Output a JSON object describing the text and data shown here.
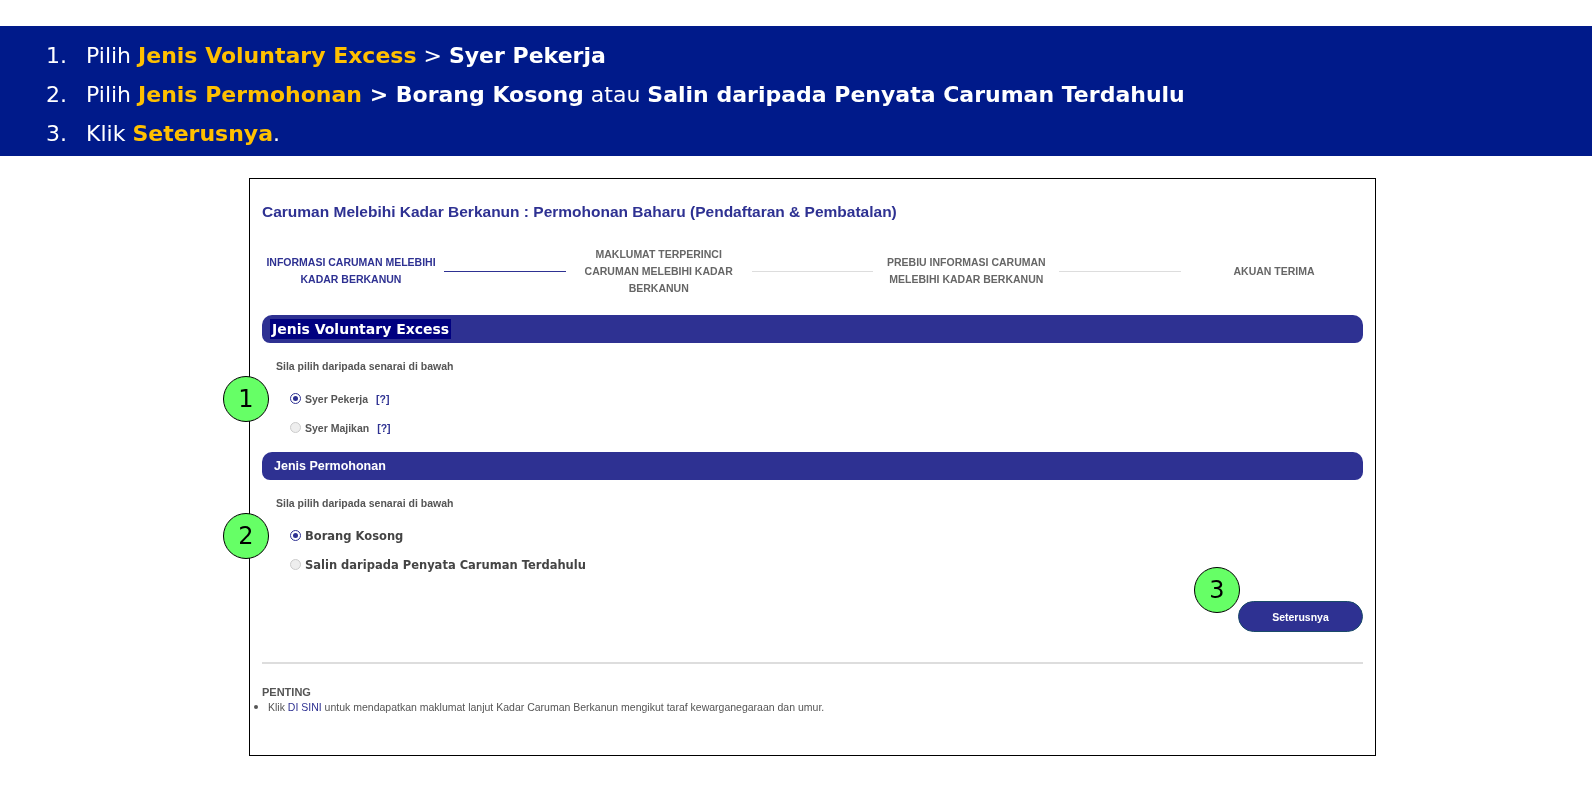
{
  "instructions": [
    {
      "number": "1.",
      "segments": [
        {
          "kind": "plain",
          "text": "Pilih "
        },
        {
          "kind": "highlight",
          "text": "Jenis Voluntary Excess"
        },
        {
          "kind": "plain",
          "text": " > "
        },
        {
          "kind": "bold",
          "text": "Syer Pekerja"
        }
      ]
    },
    {
      "number": "2.",
      "segments": [
        {
          "kind": "plain",
          "text": "Pilih "
        },
        {
          "kind": "highlight",
          "text": "Jenis Permohonan"
        },
        {
          "kind": "bold",
          "text": " > Borang Kosong"
        },
        {
          "kind": "plain",
          "text": " atau "
        },
        {
          "kind": "bold",
          "text": "Salin daripada Penyata Caruman Terdahulu"
        }
      ]
    },
    {
      "number": "3.",
      "segments": [
        {
          "kind": "plain",
          "text": "Klik "
        },
        {
          "kind": "highlight",
          "text": "Seterusnya"
        },
        {
          "kind": "plain",
          "text": "."
        }
      ]
    }
  ],
  "form": {
    "title": "Caruman Melebihi Kadar Berkanun : Permohonan Baharu (Pendaftaran & Pembatalan)",
    "steps": [
      {
        "label": "INFORMASI CARUMAN MELEBIHI KADAR BERKANUN",
        "active": true
      },
      {
        "label": "MAKLUMAT TERPERINCI CARUMAN MELEBIHI KADAR BERKANUN",
        "active": false
      },
      {
        "label": "PREBIU INFORMASI CARUMAN MELEBIHI KADAR BERKANUN",
        "active": false
      },
      {
        "label": "AKUAN TERIMA",
        "active": false
      }
    ],
    "sections": [
      {
        "title": "Jenis Voluntary Excess",
        "title_highlighted": true,
        "hint": "Sila pilih daripada senarai di bawah",
        "callout": "1",
        "options": [
          {
            "label": "Syer Pekerja",
            "help": "[?]",
            "selected": true
          },
          {
            "label": "Syer Majikan",
            "help": "[?]",
            "selected": false
          }
        ]
      },
      {
        "title": "Jenis Permohonan",
        "title_highlighted": false,
        "hint": "Sila pilih daripada senarai di bawah",
        "callout": "2",
        "options": [
          {
            "label": "Borang Kosong",
            "selected": true
          },
          {
            "label": "Salin daripada Penyata Caruman Terdahulu",
            "selected": false
          }
        ]
      }
    ],
    "next_button": {
      "label": "Seterusnya",
      "callout": "3"
    },
    "notice": {
      "heading": "PENTING",
      "items": [
        {
          "before": "Klik ",
          "link": "DI SINI",
          "after": " untuk mendapatkan maklumat lanjut Kadar Caruman Berkanun mengikut taraf kewarganegaraan dan umur."
        }
      ]
    }
  }
}
